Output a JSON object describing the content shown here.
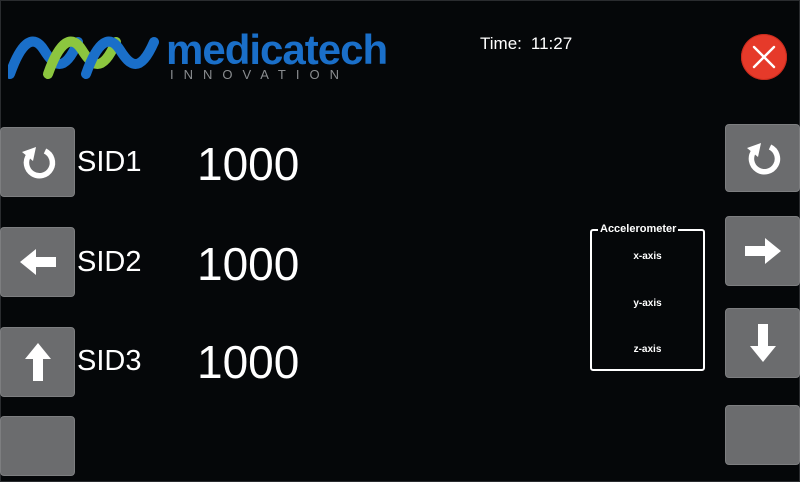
{
  "logo": {
    "word": "medicatech",
    "subtitle": "INNOVATION",
    "colors": {
      "blue": "#1a6fc9",
      "green": "#8cc63f",
      "sub": "#8a8d90"
    }
  },
  "time": {
    "label": "Time:",
    "value": "11:27"
  },
  "close_button": {
    "icon": "close-icon",
    "color": "#e63a2a"
  },
  "left_buttons": [
    {
      "icon": "rotate-icon"
    },
    {
      "icon": "arrow-left-icon"
    },
    {
      "icon": "arrow-up-icon"
    },
    {
      "icon": ""
    }
  ],
  "right_buttons": [
    {
      "icon": "rotate-icon"
    },
    {
      "icon": "arrow-right-icon"
    },
    {
      "icon": "arrow-down-icon"
    },
    {
      "icon": ""
    }
  ],
  "sids": [
    {
      "label": "SID1",
      "value": "1000"
    },
    {
      "label": "SID2",
      "value": "1000"
    },
    {
      "label": "SID3",
      "value": "1000"
    }
  ],
  "accelerometer": {
    "title": "Accelerometer",
    "axes": [
      "x-axis",
      "y-axis",
      "z-axis"
    ]
  },
  "colors": {
    "background": "#050709",
    "button": "#6b6c6e",
    "text": "#ffffff"
  }
}
